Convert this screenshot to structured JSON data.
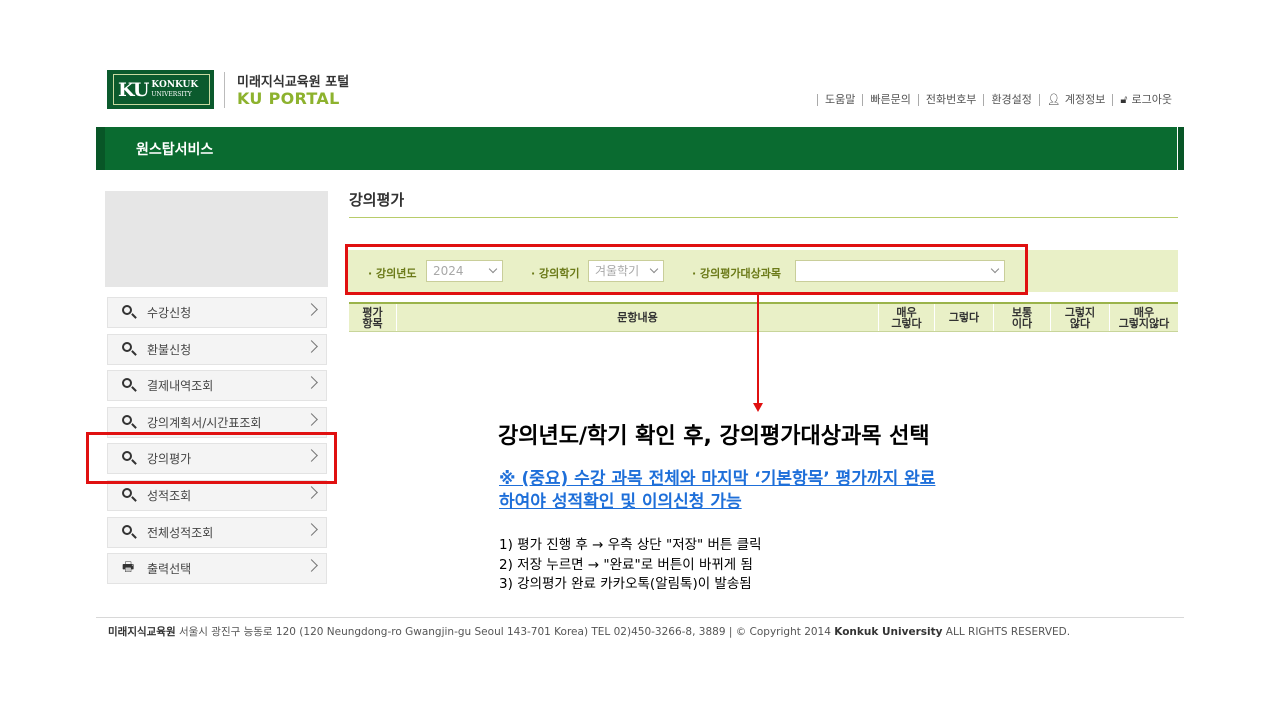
{
  "header": {
    "logo_ku": "KU",
    "logo_konkuk": "KONKUK",
    "logo_university": "UNIVERSITY",
    "portal_title": "미래지식교육원 포털",
    "portal_sub": "KU PORTAL",
    "links": [
      "도움말",
      "빠른문의",
      "전화번호부",
      "환경설정",
      "계정정보",
      "로그아웃"
    ]
  },
  "nav": {
    "title": "원스탑서비스"
  },
  "sidebar": {
    "items": [
      {
        "label": "수강신청",
        "icon": "search-icon"
      },
      {
        "label": "환불신청",
        "icon": "search-icon"
      },
      {
        "label": "결제내역조회",
        "icon": "search-icon"
      },
      {
        "label": "강의계획서/시간표조회",
        "icon": "search-icon"
      },
      {
        "label": "강의평가",
        "icon": "search-icon"
      },
      {
        "label": "성적조회",
        "icon": "search-icon"
      },
      {
        "label": "전체성적조회",
        "icon": "search-icon"
      },
      {
        "label": "출력선택",
        "icon": "printer-icon"
      }
    ]
  },
  "main": {
    "title": "강의평가",
    "filters": {
      "year_label": "· 강의년도",
      "year_value": "2024",
      "semester_label": "· 강의학기",
      "semester_value": "겨울학기",
      "course_label": "· 강의평가대상과목",
      "course_value": ""
    },
    "table_headers": [
      "평가\n항목",
      "문항내용",
      "매우\n그렇다",
      "그렇다",
      "보통\n이다",
      "그렇지\n않다",
      "매우\n그렇지않다"
    ]
  },
  "annotation": {
    "title": "강의년도/학기 확인 후, 강의평가대상과목 선택",
    "note_line1": "※ (중요) 수강 과목 전체와 마지막 ‘기본항목’ 평가까지 완료",
    "note_line2": "하여야 성적확인 및 이의신청 가능",
    "step1": "1) 평가 진행 후 → 우측 상단 \"저장\" 버튼 클릭",
    "step2": "2) 저장 누르면 → \"완료\"로 버튼이 바뀌게 됨",
    "step3": "3) 강의평가 완료 카카오톡(알림톡)이 발송됨"
  },
  "footer": {
    "org": "미래지식교육원",
    "address": " 서울시 광진구 능동로 120 (120 Neungdong-ro Gwangjin-gu Seoul 143-701 Korea) TEL 02)450-3266-8, 3889 | © Copyright 2014 ",
    "company": "Konkuk University",
    "rights": " ALL RIGHTS RESERVED."
  },
  "colors": {
    "brand_green": "#0a6b30",
    "accent_lime": "#8db22e",
    "highlight_red": "#e01010",
    "link_blue": "#1e6fd9"
  }
}
